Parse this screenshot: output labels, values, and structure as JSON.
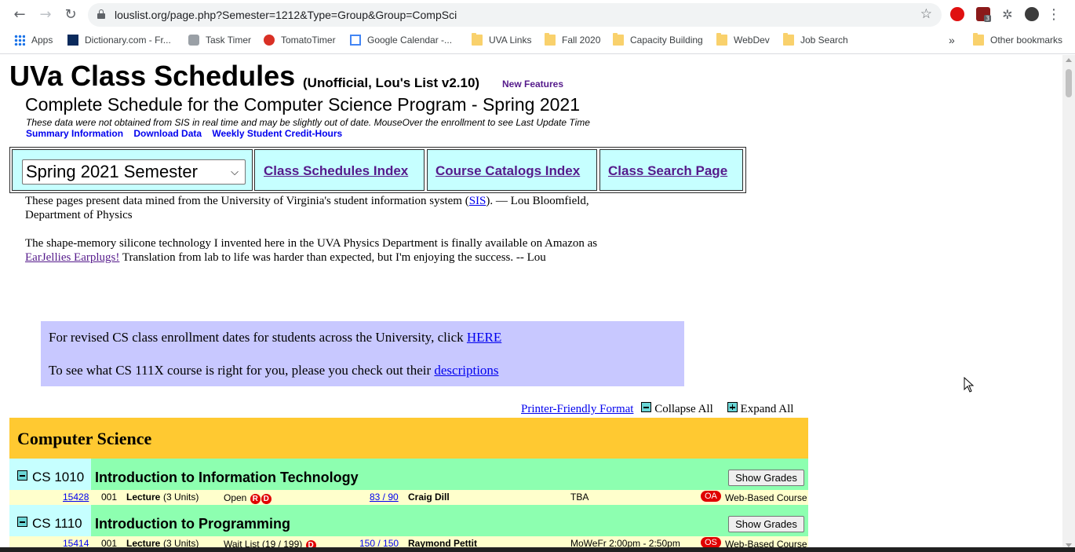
{
  "browser": {
    "url": "louslist.org/page.php?Semester=1212&Type=Group&Group=CompSci",
    "extension_badge": "3",
    "bookmarks": [
      "Apps",
      "Dictionary.com - Fr...",
      "Task Timer",
      "TomatoTimer",
      "Google Calendar -...",
      "UVA Links",
      "Fall 2020",
      "Capacity Building",
      "WebDev",
      "Job Search"
    ],
    "more_bookmarks": "»",
    "other_bookmarks": "Other bookmarks"
  },
  "header": {
    "site_title": "UVa Class Schedules",
    "site_subtitle": "(Unofficial, Lou's List v2.10)",
    "new_features": "New Features",
    "program_title": "Complete Schedule for the Computer Science Program - Spring 2021",
    "data_note": "These data were not obtained from SIS in real time and may be slightly out of date. MouseOver the enrollment to see Last Update Time",
    "links": [
      "Summary Information",
      "Download Data",
      "Weekly Student Credit-Hours"
    ]
  },
  "nav": {
    "semester_select": "Spring 2021 Semester",
    "links": [
      "Class Schedules Index",
      "Course Catalogs Index",
      "Class Search Page"
    ]
  },
  "intro": {
    "p1_before": "These pages present data mined from the University of Virginia's student information system (",
    "p1_link": "SIS",
    "p1_after": "). — Lou Bloomfield,",
    "p1_line2": "Department of Physics",
    "p2_line1": "The shape-memory silicone technology I invented here in the UVA Physics Department is finally available on Amazon as",
    "p2_link": "EarJellies Earplugs!",
    "p2_after": " Translation from lab to life was harder than expected, but I'm enjoying the success. -- Lou"
  },
  "infobox": {
    "line1_text": "For revised CS class enrollment dates for students across the University, click ",
    "line1_link": "HERE",
    "line2_text": "To see what CS 111X course is right for you, please you check out their ",
    "line2_link": "descriptions"
  },
  "controls": {
    "printer_friendly": "Printer-Friendly Format",
    "collapse_all": "Collapse All",
    "expand_all": "Expand All"
  },
  "department": "Computer Science",
  "courses": [
    {
      "number": "CS 1010",
      "title": "Introduction to Information Technology",
      "show_grades": "Show Grades",
      "section": {
        "class_number": "15428",
        "section": "001",
        "type": "Lecture",
        "units": "(3 Units)",
        "status": "Open",
        "status_icons": [
          "R",
          "D"
        ],
        "enrollment": "83 / 90",
        "instructor": "Craig Dill",
        "time": "TBA",
        "mode_badge": "OA",
        "location": "Web-Based Course"
      }
    },
    {
      "number": "CS 1110",
      "title": "Introduction to Programming",
      "show_grades": "Show Grades",
      "section": {
        "class_number": "15414",
        "section": "001",
        "type": "Lecture",
        "units": "(3 Units)",
        "status": "Wait List (19 / 199)",
        "status_icons": [
          "D"
        ],
        "enrollment": "150 / 150",
        "instructor": "Raymond Pettit",
        "time": "MoWeFr 2:00pm - 2:50pm",
        "mode_badge": "OS",
        "location": "Web-Based Course"
      }
    }
  ],
  "colors": {
    "dept_bar": "#ffc931",
    "course_head": "#8dffb0",
    "course_num": "#c6ffff",
    "section_row": "#ffffcc",
    "infobox": "#c8c8ff",
    "badge": "#e00000"
  }
}
